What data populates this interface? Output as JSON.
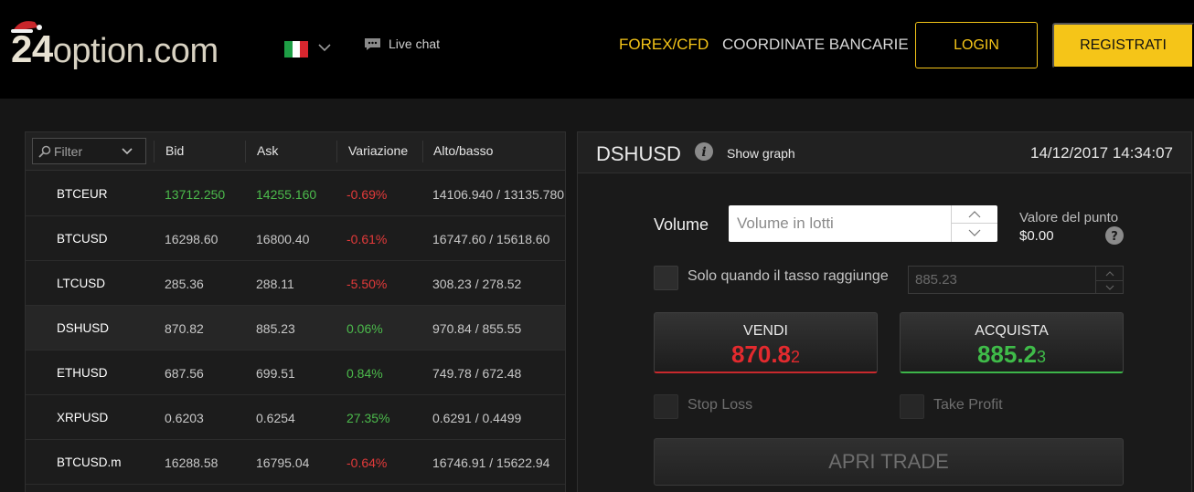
{
  "header": {
    "logo_num": "24",
    "logo_text": "option.com",
    "live_chat": "Live chat",
    "nav_forex": "FOREX/CFD",
    "nav_coord": "COORDINATE BANCARIE",
    "login": "LOGIN",
    "register": "REGISTRATI",
    "brand_color": "#f5c518"
  },
  "table": {
    "filter_placeholder": "Filter",
    "columns": [
      "Bid",
      "Ask",
      "Variazione",
      "Alto/basso"
    ],
    "rows": [
      {
        "symbol": "BTCEUR",
        "bid": "13712.250",
        "ask": "14255.160",
        "var": "-0.69%",
        "hl": "14106.940 / 13135.780",
        "dir": "down",
        "bid_up": true
      },
      {
        "symbol": "BTCUSD",
        "bid": "16298.60",
        "ask": "16800.40",
        "var": "-0.61%",
        "hl": "16747.60 / 15618.60",
        "dir": "down",
        "bid_up": false
      },
      {
        "symbol": "LTCUSD",
        "bid": "285.36",
        "ask": "288.11",
        "var": "-5.50%",
        "hl": "308.23 / 278.52",
        "dir": "down",
        "bid_up": false
      },
      {
        "symbol": "DSHUSD",
        "bid": "870.82",
        "ask": "885.23",
        "var": "0.06%",
        "hl": "970.84 / 855.55",
        "dir": "up",
        "bid_up": false
      },
      {
        "symbol": "ETHUSD",
        "bid": "687.56",
        "ask": "699.51",
        "var": "0.84%",
        "hl": "749.78 / 672.48",
        "dir": "up",
        "bid_up": false
      },
      {
        "symbol": "XRPUSD",
        "bid": "0.6203",
        "ask": "0.6254",
        "var": "27.35%",
        "hl": "0.6291 / 0.4499",
        "dir": "up",
        "bid_up": false
      },
      {
        "symbol": "BTCUSD.m",
        "bid": "16288.58",
        "ask": "16795.04",
        "var": "-0.64%",
        "hl": "16746.91 / 15622.94",
        "dir": "down",
        "bid_up": false
      }
    ]
  },
  "trade": {
    "symbol": "DSHUSD",
    "show_graph": "Show graph",
    "datetime": "14/12/2017 14:34:07",
    "volume_label": "Volume",
    "volume_placeholder": "Volume in lotti",
    "point_value_label": "Valore del punto",
    "point_value": "$0.00",
    "rate_label": "Solo quando il tasso raggiunge",
    "rate_value": "885.23",
    "sell_label": "VENDI",
    "sell_price_main": "870.8",
    "sell_price_pip": "2",
    "buy_label": "ACQUISTA",
    "buy_price_main": "885.2",
    "buy_price_pip": "3",
    "stop_loss": "Stop Loss",
    "take_profit": "Take Profit",
    "open_trade": "APRI TRADE"
  }
}
